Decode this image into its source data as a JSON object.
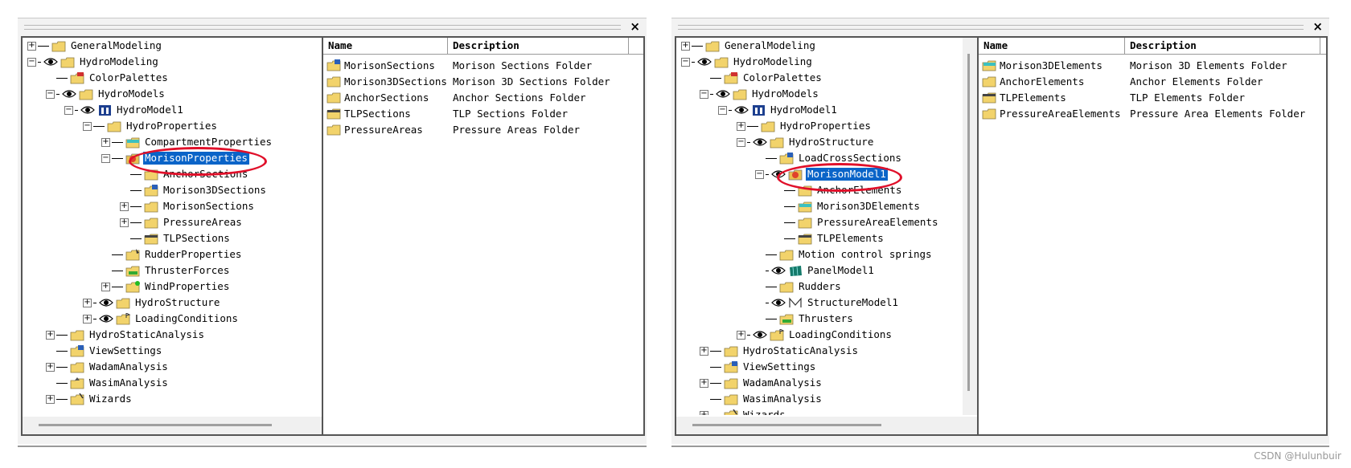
{
  "left": {
    "tree": [
      {
        "label": "GeneralModeling",
        "expander": "+",
        "icon": "folder"
      },
      {
        "label": "HydroModeling",
        "expander": "-",
        "eye": true,
        "icon": "folder"
      },
      {
        "label": "ColorPalettes",
        "icon": "folder-palette"
      },
      {
        "label": "HydroModels",
        "expander": "-",
        "eye": true,
        "icon": "folder"
      },
      {
        "label": "HydroModel1",
        "expander": "-",
        "eye": true,
        "icon": "hydromodel"
      },
      {
        "label": "HydroProperties",
        "expander": "-",
        "icon": "folder"
      },
      {
        "label": "CompartmentProperties",
        "expander": "+",
        "icon": "folder-cyan"
      },
      {
        "label": "MorisonProperties",
        "expander": "-",
        "icon": "morison",
        "selected": true
      },
      {
        "label": "AnchorSections",
        "icon": "folder"
      },
      {
        "label": "Morison3DSections",
        "icon": "folder-blue"
      },
      {
        "label": "MorisonSections",
        "expander": "+",
        "icon": "folder"
      },
      {
        "label": "PressureAreas",
        "expander": "+",
        "icon": "folder"
      },
      {
        "label": "TLPSections",
        "icon": "folder-tlp"
      },
      {
        "label": "RudderProperties",
        "icon": "folder-rudder"
      },
      {
        "label": "ThrusterForces",
        "icon": "folder-green"
      },
      {
        "label": "WindProperties",
        "expander": "+",
        "icon": "folder-wind"
      },
      {
        "label": "HydroStructure",
        "expander": "+",
        "eye": true,
        "icon": "folder"
      },
      {
        "label": "LoadingConditions",
        "expander": "+",
        "eye": true,
        "icon": "folder-flag"
      },
      {
        "label": "HydroStaticAnalysis",
        "expander": "+",
        "icon": "folder"
      },
      {
        "label": "ViewSettings",
        "icon": "folder-blue"
      },
      {
        "label": "WadamAnalysis",
        "expander": "+",
        "icon": "folder"
      },
      {
        "label": "WasimAnalysis",
        "icon": "folder-hat"
      },
      {
        "label": "Wizards",
        "expander": "+",
        "icon": "folder-wand"
      }
    ],
    "columns": {
      "name": "Name",
      "description": "Description"
    },
    "rows": [
      {
        "name": "MorisonSections",
        "description": "Morison Sections Folder",
        "icon": "folder-blue"
      },
      {
        "name": "Morison3DSections",
        "description": "Morison 3D Sections Folder",
        "icon": "folder"
      },
      {
        "name": "AnchorSections",
        "description": "Anchor Sections Folder",
        "icon": "folder"
      },
      {
        "name": "TLPSections",
        "description": "TLP Sections Folder",
        "icon": "folder-tlp"
      },
      {
        "name": "PressureAreas",
        "description": "Pressure Areas Folder",
        "icon": "folder"
      }
    ]
  },
  "right": {
    "tree": [
      {
        "label": "GeneralModeling",
        "expander": "+",
        "icon": "folder"
      },
      {
        "label": "HydroModeling",
        "expander": "-",
        "eye": true,
        "icon": "folder"
      },
      {
        "label": "ColorPalettes",
        "icon": "folder-palette"
      },
      {
        "label": "HydroModels",
        "expander": "-",
        "eye": true,
        "icon": "folder"
      },
      {
        "label": "HydroModel1",
        "expander": "-",
        "eye": true,
        "icon": "hydromodel"
      },
      {
        "label": "HydroProperties",
        "expander": "+",
        "icon": "folder"
      },
      {
        "label": "HydroStructure",
        "expander": "-",
        "eye": true,
        "icon": "folder"
      },
      {
        "label": "LoadCrossSections",
        "icon": "folder-blue"
      },
      {
        "label": "MorisonModel1",
        "expander": "-",
        "eye": true,
        "icon": "morison",
        "selected": true
      },
      {
        "label": "AnchorElements",
        "icon": "folder"
      },
      {
        "label": "Morison3DElements",
        "icon": "folder-cyan"
      },
      {
        "label": "PressureAreaElements",
        "icon": "folder"
      },
      {
        "label": "TLPElements",
        "icon": "folder-tlp"
      },
      {
        "label": "Motion control springs",
        "icon": "folder"
      },
      {
        "label": "PanelModel1",
        "eye": true,
        "icon": "panel"
      },
      {
        "label": "Rudders",
        "icon": "folder"
      },
      {
        "label": "StructureModel1",
        "eye": true,
        "icon": "structure"
      },
      {
        "label": "Thrusters",
        "icon": "folder-green"
      },
      {
        "label": "LoadingConditions",
        "expander": "+",
        "eye": true,
        "icon": "folder-flag"
      },
      {
        "label": "HydroStaticAnalysis",
        "expander": "+",
        "icon": "folder"
      },
      {
        "label": "ViewSettings",
        "icon": "folder-blue"
      },
      {
        "label": "WadamAnalysis",
        "expander": "+",
        "icon": "folder"
      },
      {
        "label": "WasimAnalysis",
        "icon": "folder"
      },
      {
        "label": "Wizards",
        "expander": "+",
        "icon": "folder-wand"
      }
    ],
    "columns": {
      "name": "Name",
      "description": "Description"
    },
    "rows": [
      {
        "name": "Morison3DElements",
        "description": "Morison 3D Elements Folder",
        "icon": "folder-cyan"
      },
      {
        "name": "AnchorElements",
        "description": "Anchor Elements Folder",
        "icon": "folder"
      },
      {
        "name": "TLPElements",
        "description": "TLP Elements Folder",
        "icon": "folder-tlp"
      },
      {
        "name": "PressureAreaElements",
        "description": "Pressure Area Elements Folder",
        "icon": "folder"
      }
    ]
  },
  "close_glyph": "×",
  "watermark": "CSDN @Hulunbuir",
  "colors": {
    "selection": "#0a64c8",
    "highlight_ring": "#e0102a",
    "folder": "#f2d36b"
  }
}
